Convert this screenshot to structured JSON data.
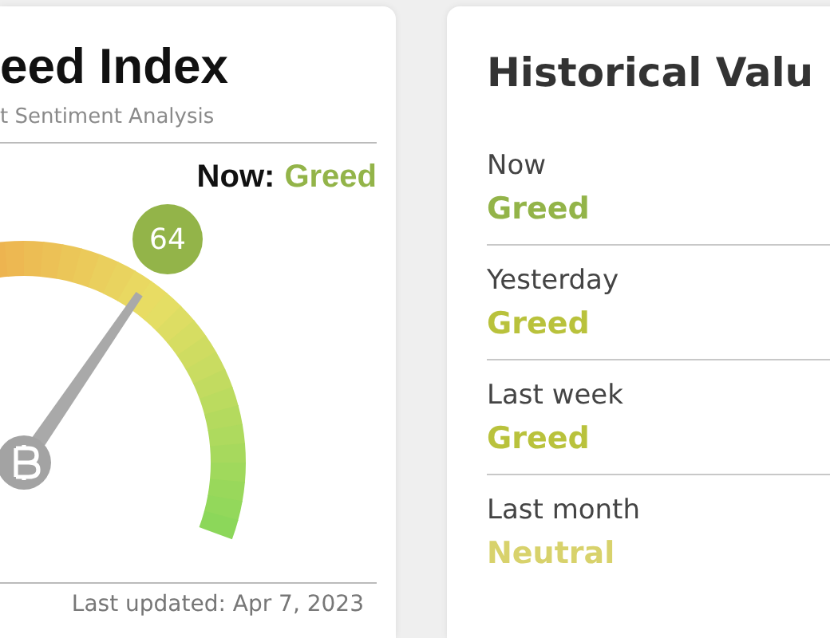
{
  "index_card": {
    "title": "eed Index",
    "subtitle": "t Sentiment Analysis",
    "now_label": "Now:",
    "now_value": "Greed",
    "value": "64",
    "last_updated": "Last updated: Apr 7, 2023"
  },
  "history_card": {
    "title": "Historical Valu",
    "rows": [
      {
        "label": "Now",
        "value": "Greed",
        "color": "#93b449"
      },
      {
        "label": "Yesterday",
        "value": "Greed",
        "color": "#b9c23c"
      },
      {
        "label": "Last week",
        "value": "Greed",
        "color": "#b9c23c"
      },
      {
        "label": "Last month",
        "value": "Neutral",
        "color": "#d8d26c"
      }
    ]
  }
}
